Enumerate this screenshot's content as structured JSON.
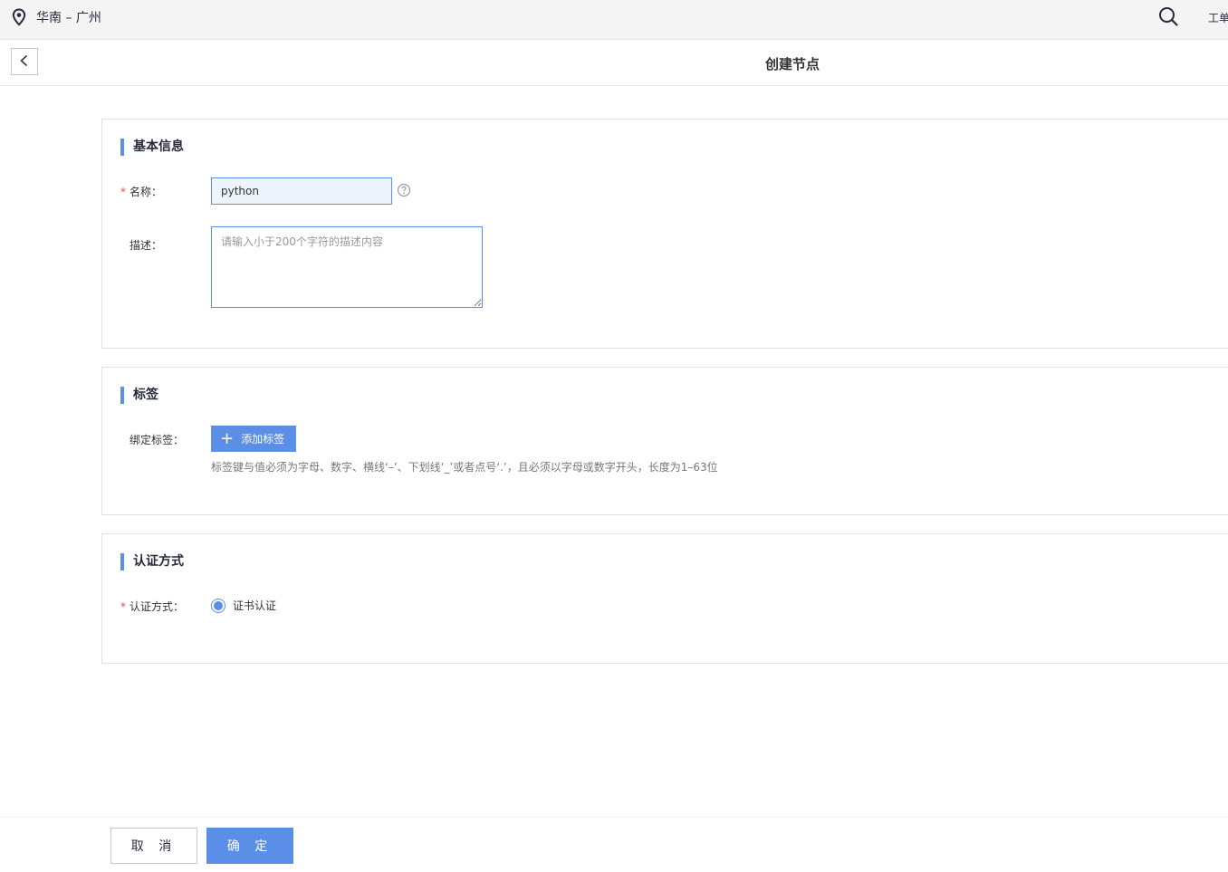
{
  "topbar": {
    "region": "华南 – 广州",
    "region_icon": "location-pin-icon",
    "search_icon": "search-icon",
    "work_order_label": "工单"
  },
  "header": {
    "back_icon": "chevron-left-icon",
    "title": "创建节点"
  },
  "basic_info": {
    "section_title": "基本信息",
    "name_label": "名称",
    "name_value": "python",
    "help_icon": "question-circle-icon",
    "description_label": "描述",
    "description_placeholder": "请输入小于200个字符的描述内容"
  },
  "tags": {
    "section_title": "标签",
    "bind_label": "绑定标签",
    "add_button_label": "添加标签",
    "hint": "标签键与值必须为字母、数字、横线‘–’、下划线‘_’或者点号‘.’，且必须以字母或数字开头，长度为1–63位"
  },
  "auth": {
    "section_title": "认证方式",
    "method_label": "认证方式",
    "selected_option": "证书认证"
  },
  "footer": {
    "cancel_label": "取 消",
    "ok_label": "确 定"
  },
  "colors": {
    "accent": "#5b8ee6",
    "required": "#e84a4a"
  }
}
